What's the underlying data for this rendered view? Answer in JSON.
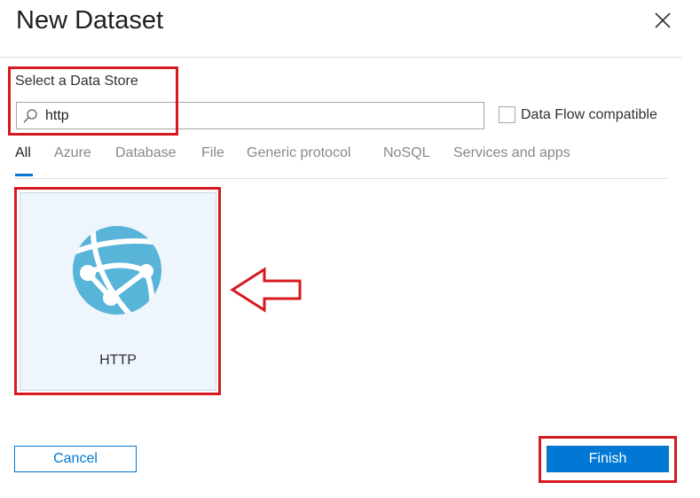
{
  "dialog": {
    "title": "New Dataset"
  },
  "store": {
    "label": "Select a Data Store",
    "search_value": "http",
    "dataflow_label": "Data Flow compatible",
    "dataflow_checked": false
  },
  "tabs": [
    {
      "label": "All",
      "active": true
    },
    {
      "label": "Azure",
      "active": false
    },
    {
      "label": "Database",
      "active": false
    },
    {
      "label": "File",
      "active": false
    },
    {
      "label": "Generic protocol",
      "active": false
    },
    {
      "label": "NoSQL",
      "active": false
    },
    {
      "label": "Services and apps",
      "active": false
    }
  ],
  "results": [
    {
      "label": "HTTP",
      "icon": "globe-network-icon"
    }
  ],
  "footer": {
    "cancel_label": "Cancel",
    "finish_label": "Finish"
  },
  "colors": {
    "accent": "#0078d4",
    "highlight": "#d7191f",
    "icon": "#59b4d9",
    "tile_bg": "#eef5fc"
  }
}
